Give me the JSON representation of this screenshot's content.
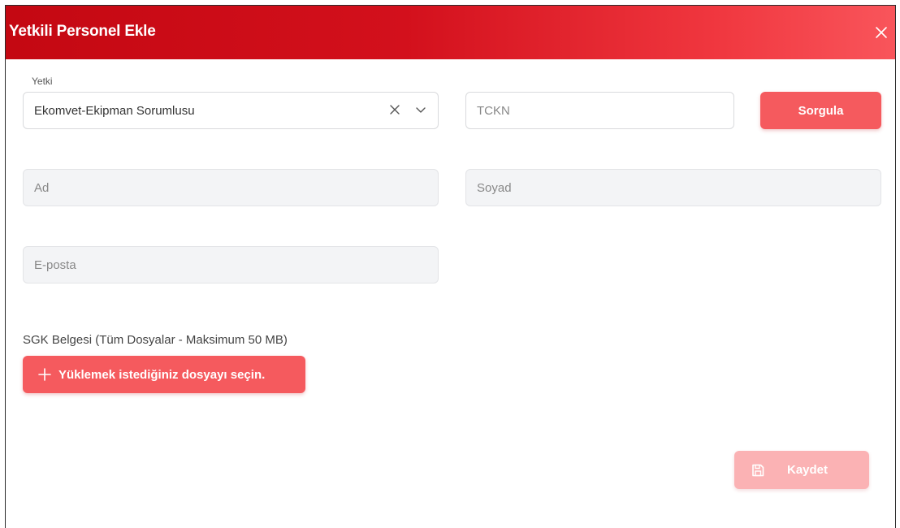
{
  "dialog": {
    "title": "Yetkili Personel Ekle",
    "close_icon": "close-icon"
  },
  "form": {
    "yetki": {
      "label": "Yetki",
      "value": "Ekomvet-Ekipman Sorumlusu",
      "clear_icon": "x-icon",
      "dropdown_icon": "chevron-down-icon"
    },
    "tckn": {
      "placeholder": "TCKN"
    },
    "sorgula_label": "Sorgula",
    "ad": {
      "placeholder": "Ad"
    },
    "soyad": {
      "placeholder": "Soyad"
    },
    "eposta": {
      "placeholder": "E-posta"
    },
    "upload": {
      "label": "SGK Belgesi (Tüm Dosyalar - Maksimum 50 MB)",
      "button_label": "Yüklemek istediğiniz dosyayı seçin.",
      "button_icon": "plus-icon"
    },
    "save": {
      "label": "Kaydet",
      "icon": "save-icon",
      "enabled": false
    }
  },
  "colors": {
    "header_start": "#c40812",
    "header_end": "#f9555b",
    "primary_button": "#f55a5e",
    "disabled_button": "#fbb2b4"
  }
}
